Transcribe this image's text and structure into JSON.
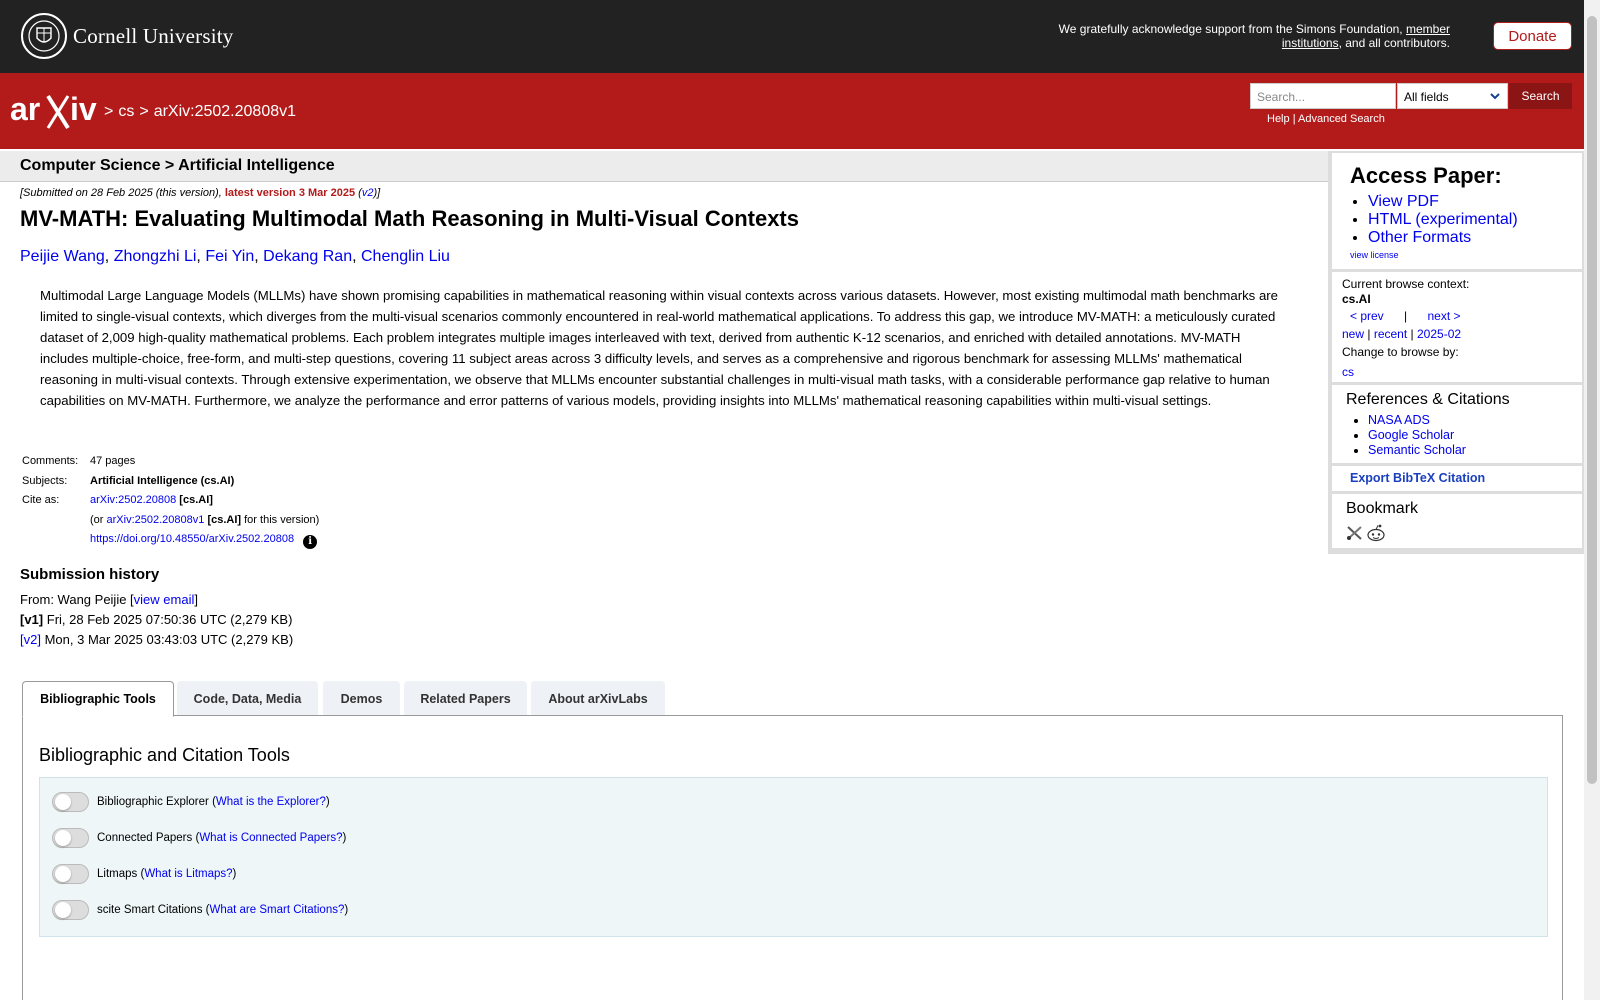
{
  "cornell": {
    "name": "Cornell University",
    "support_prefix": "We gratefully acknowledge support from the Simons Foundation,",
    "support_link": "member institutions",
    "support_suffix": ", and all contributors.",
    "donate": "Donate"
  },
  "header": {
    "crumb_sep": ">",
    "crumb_cs": "cs",
    "crumb_id": "arXiv:2502.20808v1",
    "search_placeholder": "Search...",
    "search_field": "All fields",
    "search_button": "Search",
    "help": "Help",
    "link_sep": "|",
    "advanced": "Advanced Search"
  },
  "subject": "Computer Science > Artificial Intelligence",
  "dateline": {
    "submitted": "[Submitted on 28 Feb 2025 (this version),",
    "latest": "latest version 3 Mar 2025",
    "open_paren": "(",
    "v2": "v2",
    "close": ")]"
  },
  "paper": {
    "title": "MV-MATH: Evaluating Multimodal Math Reasoning in Multi-Visual Contexts",
    "authors": [
      "Peijie Wang",
      "Zhongzhi Li",
      "Fei Yin",
      "Dekang Ran",
      "Chenglin Liu"
    ],
    "author_sep": ",",
    "abstract": "Multimodal Large Language Models (MLLMs) have shown promising capabilities in mathematical reasoning within visual contexts across various datasets. However, most existing multimodal math benchmarks are limited to single-visual contexts, which diverges from the multi-visual scenarios commonly encountered in real-world mathematical applications. To address this gap, we introduce MV-MATH: a meticulously curated dataset of 2,009 high-quality mathematical problems. Each problem integrates multiple images interleaved with text, derived from authentic K-12 scenarios, and enriched with detailed annotations. MV-MATH includes multiple-choice, free-form, and multi-step questions, covering 11 subject areas across 3 difficulty levels, and serves as a comprehensive and rigorous benchmark for assessing MLLMs' mathematical reasoning in multi-visual contexts. Through extensive experimentation, we observe that MLLMs encounter substantial challenges in multi-visual math tasks, with a considerable performance gap relative to human capabilities on MV-MATH. Furthermore, we analyze the performance and error patterns of various models, providing insights into MLLMs' mathematical reasoning capabilities within multi-visual settings."
  },
  "meta": {
    "comments_label": "Comments:",
    "comments": "47 pages",
    "subjects_label": "Subjects:",
    "subjects": "Artificial Intelligence (cs.AI)",
    "cite_label": "Cite as:",
    "cite_id": "arXiv:2502.20808",
    "cite_cat": "[cs.AI]",
    "or_prefix": "(or",
    "or_id": "arXiv:2502.20808v1",
    "or_cat": "[cs.AI]",
    "or_suffix": "for this version)",
    "doi": "https://doi.org/10.48550/arXiv.2502.20808",
    "info_glyph": "i"
  },
  "history": {
    "title": "Submission history",
    "from_prefix": "From: Wang Peijie [",
    "view_email": "view email",
    "from_suffix": "]",
    "v1_label": "[v1]",
    "v1": "Fri, 28 Feb 2025 07:50:36 UTC (2,279 KB)",
    "v2_label": "[v2]",
    "v2": "Mon, 3 Mar 2025 03:43:03 UTC (2,279 KB)"
  },
  "tabs": [
    "Bibliographic Tools",
    "Code, Data, Media",
    "Demos",
    "Related Papers",
    "About arXivLabs"
  ],
  "tools": {
    "heading": "Bibliographic and Citation Tools",
    "items": [
      {
        "name": "Bibliographic Explorer",
        "link": "What is the Explorer?"
      },
      {
        "name": "Connected Papers",
        "link": "What is Connected Papers?"
      },
      {
        "name": "Litmaps",
        "link": "What is Litmaps?"
      },
      {
        "name": "scite Smart Citations",
        "link": "What are Smart Citations?"
      }
    ],
    "open": "(",
    "close": ")"
  },
  "sidebar": {
    "access_title": "Access Paper:",
    "access_links": [
      "View PDF",
      "HTML (experimental)",
      "Other Formats"
    ],
    "license": "view license",
    "browse_label": "Current browse context:",
    "browse_context": "cs.AI",
    "prev": "< prev",
    "sep": "|",
    "next": "next >",
    "new": "new",
    "recent": "recent",
    "month": "2025-02",
    "change_label": "Change to browse by:",
    "cs": "cs",
    "refs_title": "References & Citations",
    "refs": [
      "NASA ADS",
      "Google Scholar",
      "Semantic Scholar"
    ],
    "export": "Export BibTeX Citation",
    "bookmark": "Bookmark"
  },
  "colors": {
    "arxiv_red": "#b31b1b",
    "cornell_dark": "#222222",
    "link_blue": "#0000ee"
  }
}
